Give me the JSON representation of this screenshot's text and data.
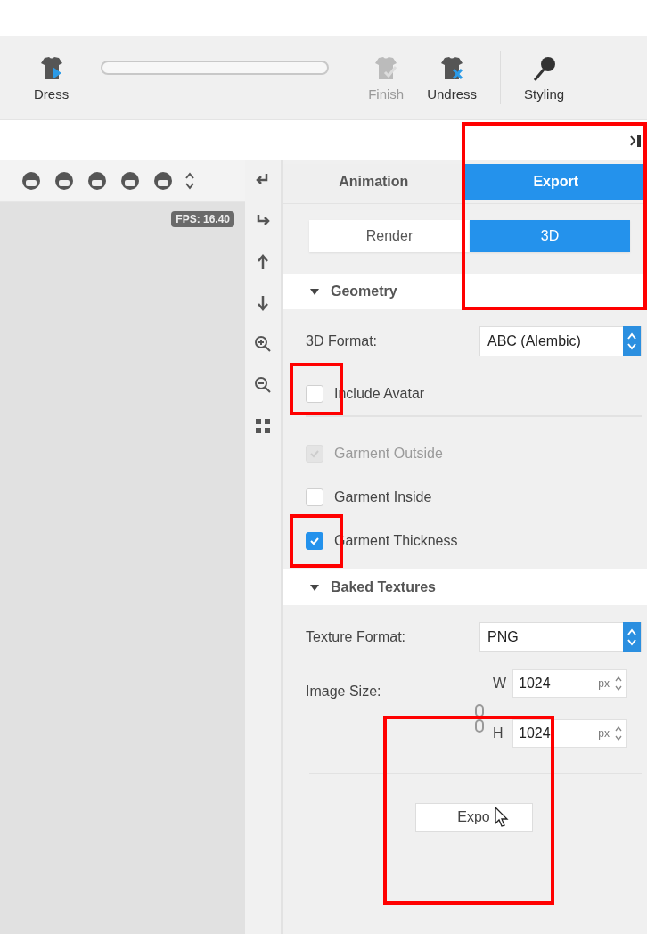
{
  "toolbar": {
    "items": [
      {
        "kind": "dress",
        "label": "Dress",
        "disabled": false
      },
      {
        "kind": "progress",
        "level": 0
      },
      {
        "kind": "finish",
        "label": "Finish",
        "disabled": true
      },
      {
        "kind": "undress",
        "label": "Undress",
        "disabled": false
      },
      {
        "kind": "divider"
      },
      {
        "kind": "styling",
        "label": "Styling",
        "disabled": false
      }
    ]
  },
  "viewport": {
    "fps": "FPS: 16.40"
  },
  "panel": {
    "tabs": [
      {
        "label": "Animation",
        "selected": false
      },
      {
        "label": "Export",
        "selected": true
      }
    ],
    "subtabs": [
      {
        "label": "Render",
        "selected": false
      },
      {
        "label": "3D",
        "selected": true
      }
    ],
    "geometry": {
      "title": "Geometry",
      "expanded": true,
      "format_label": "3D Format:",
      "format_value": "ABC (Alembic)",
      "checkboxes": [
        {
          "label": "Include Avatar",
          "checked": false,
          "disabled": false
        },
        {
          "label": "Garment Outside",
          "checked": true,
          "disabled": true
        },
        {
          "label": "Garment Inside",
          "checked": false,
          "disabled": false
        },
        {
          "label": "Garment Thickness",
          "checked": true,
          "disabled": false
        }
      ]
    },
    "baked": {
      "title": "Baked Textures",
      "expanded": true,
      "format_label": "Texture Format:",
      "format_value": "PNG",
      "size_label": "Image Size:",
      "dims": [
        {
          "label": "W",
          "value": "1024",
          "unit": "px"
        },
        {
          "label": "H",
          "value": "1024",
          "unit": "px"
        }
      ]
    },
    "export_button": "Expo"
  }
}
